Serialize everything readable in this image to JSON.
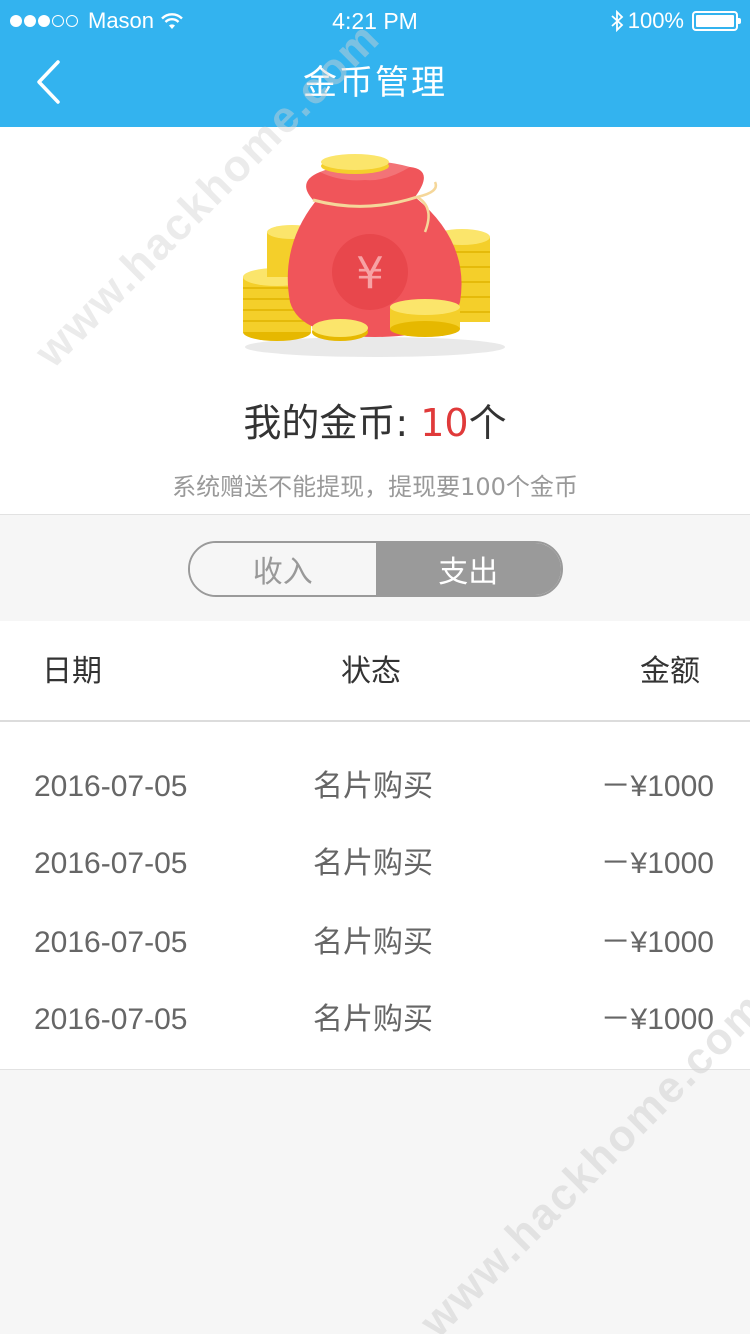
{
  "status_bar": {
    "carrier": "Mason",
    "time": "4:21 PM",
    "battery": "100%",
    "bluetooth_icon": "bluetooth-icon",
    "wifi_icon": "wifi-icon"
  },
  "nav": {
    "title": "金币管理",
    "back_icon": "chevron-left-icon"
  },
  "hero": {
    "label": "我的金币: ",
    "count": "10",
    "unit": "个",
    "note": "系统赠送不能提现，提现要100个金币"
  },
  "toggle": {
    "income": "收入",
    "expense": "支出",
    "selected": "expense"
  },
  "table": {
    "headers": {
      "date": "日期",
      "status": "状态",
      "amount": "金额"
    },
    "rows": [
      {
        "date": "2016-07-05",
        "status": "名片购买",
        "amount": "－¥1000"
      },
      {
        "date": "2016-07-05",
        "status": "名片购买",
        "amount": "－¥1000"
      },
      {
        "date": "2016-07-05",
        "status": "名片购买",
        "amount": "－¥1000"
      },
      {
        "date": "2016-07-05",
        "status": "名片购买",
        "amount": "－¥1000"
      }
    ]
  },
  "watermark": "www.hackhome.com",
  "colors": {
    "header": "#33b3ef",
    "coin_count": "#e03a3a",
    "toggle_selected": "#9a9a9a"
  }
}
